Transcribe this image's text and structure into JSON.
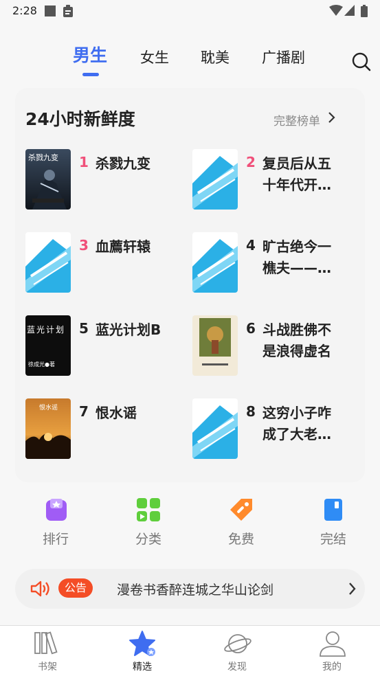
{
  "status_bar": {
    "time": "2:28"
  },
  "tabs": [
    {
      "label": "男生",
      "active": true
    },
    {
      "label": "女生",
      "active": false
    },
    {
      "label": "耽美",
      "active": false
    },
    {
      "label": "广播剧",
      "active": false
    }
  ],
  "section": {
    "title": "24小时新鲜度",
    "more_label": "完整榜单"
  },
  "books": [
    {
      "rank": "1",
      "title": "杀戮九变",
      "cover_text": "杀戮九变"
    },
    {
      "rank": "2",
      "title": "复员后从五十年代开…",
      "cover_text": ""
    },
    {
      "rank": "3",
      "title": "血薦轩辕",
      "cover_text": ""
    },
    {
      "rank": "4",
      "title": "旷古绝今一樵夫——…",
      "cover_text": ""
    },
    {
      "rank": "5",
      "title": "蓝光计划B",
      "cover_text": "蓝光计划",
      "cover_author": "徐成光●著"
    },
    {
      "rank": "6",
      "title": "斗战胜佛不是浪得虚名",
      "cover_text": ""
    },
    {
      "rank": "7",
      "title": "恨水谣",
      "cover_text": "恨水谣"
    },
    {
      "rank": "8",
      "title": "这穷小子咋成了大老…",
      "cover_text": ""
    }
  ],
  "quick_links": [
    {
      "label": "排行",
      "icon": "ranking-icon",
      "color": "#a05cf5"
    },
    {
      "label": "分类",
      "icon": "category-icon",
      "color": "#5fce3c"
    },
    {
      "label": "免费",
      "icon": "free-tag-icon",
      "color": "#ff8a2c"
    },
    {
      "label": "完结",
      "icon": "completed-book-icon",
      "color": "#2f8cf5"
    }
  ],
  "notice": {
    "badge": "公告",
    "text": "漫卷书香醉连城之华山论剑"
  },
  "bottom_nav": [
    {
      "label": "书架",
      "icon": "bookshelf-icon",
      "active": false
    },
    {
      "label": "精选",
      "icon": "featured-star-icon",
      "active": true
    },
    {
      "label": "发现",
      "icon": "discover-planet-icon",
      "active": false
    },
    {
      "label": "我的",
      "icon": "profile-icon",
      "active": false
    }
  ],
  "colors": {
    "accent": "#3f6df0",
    "rank_top": "#f0507a",
    "notice_badge": "#f44d26"
  }
}
